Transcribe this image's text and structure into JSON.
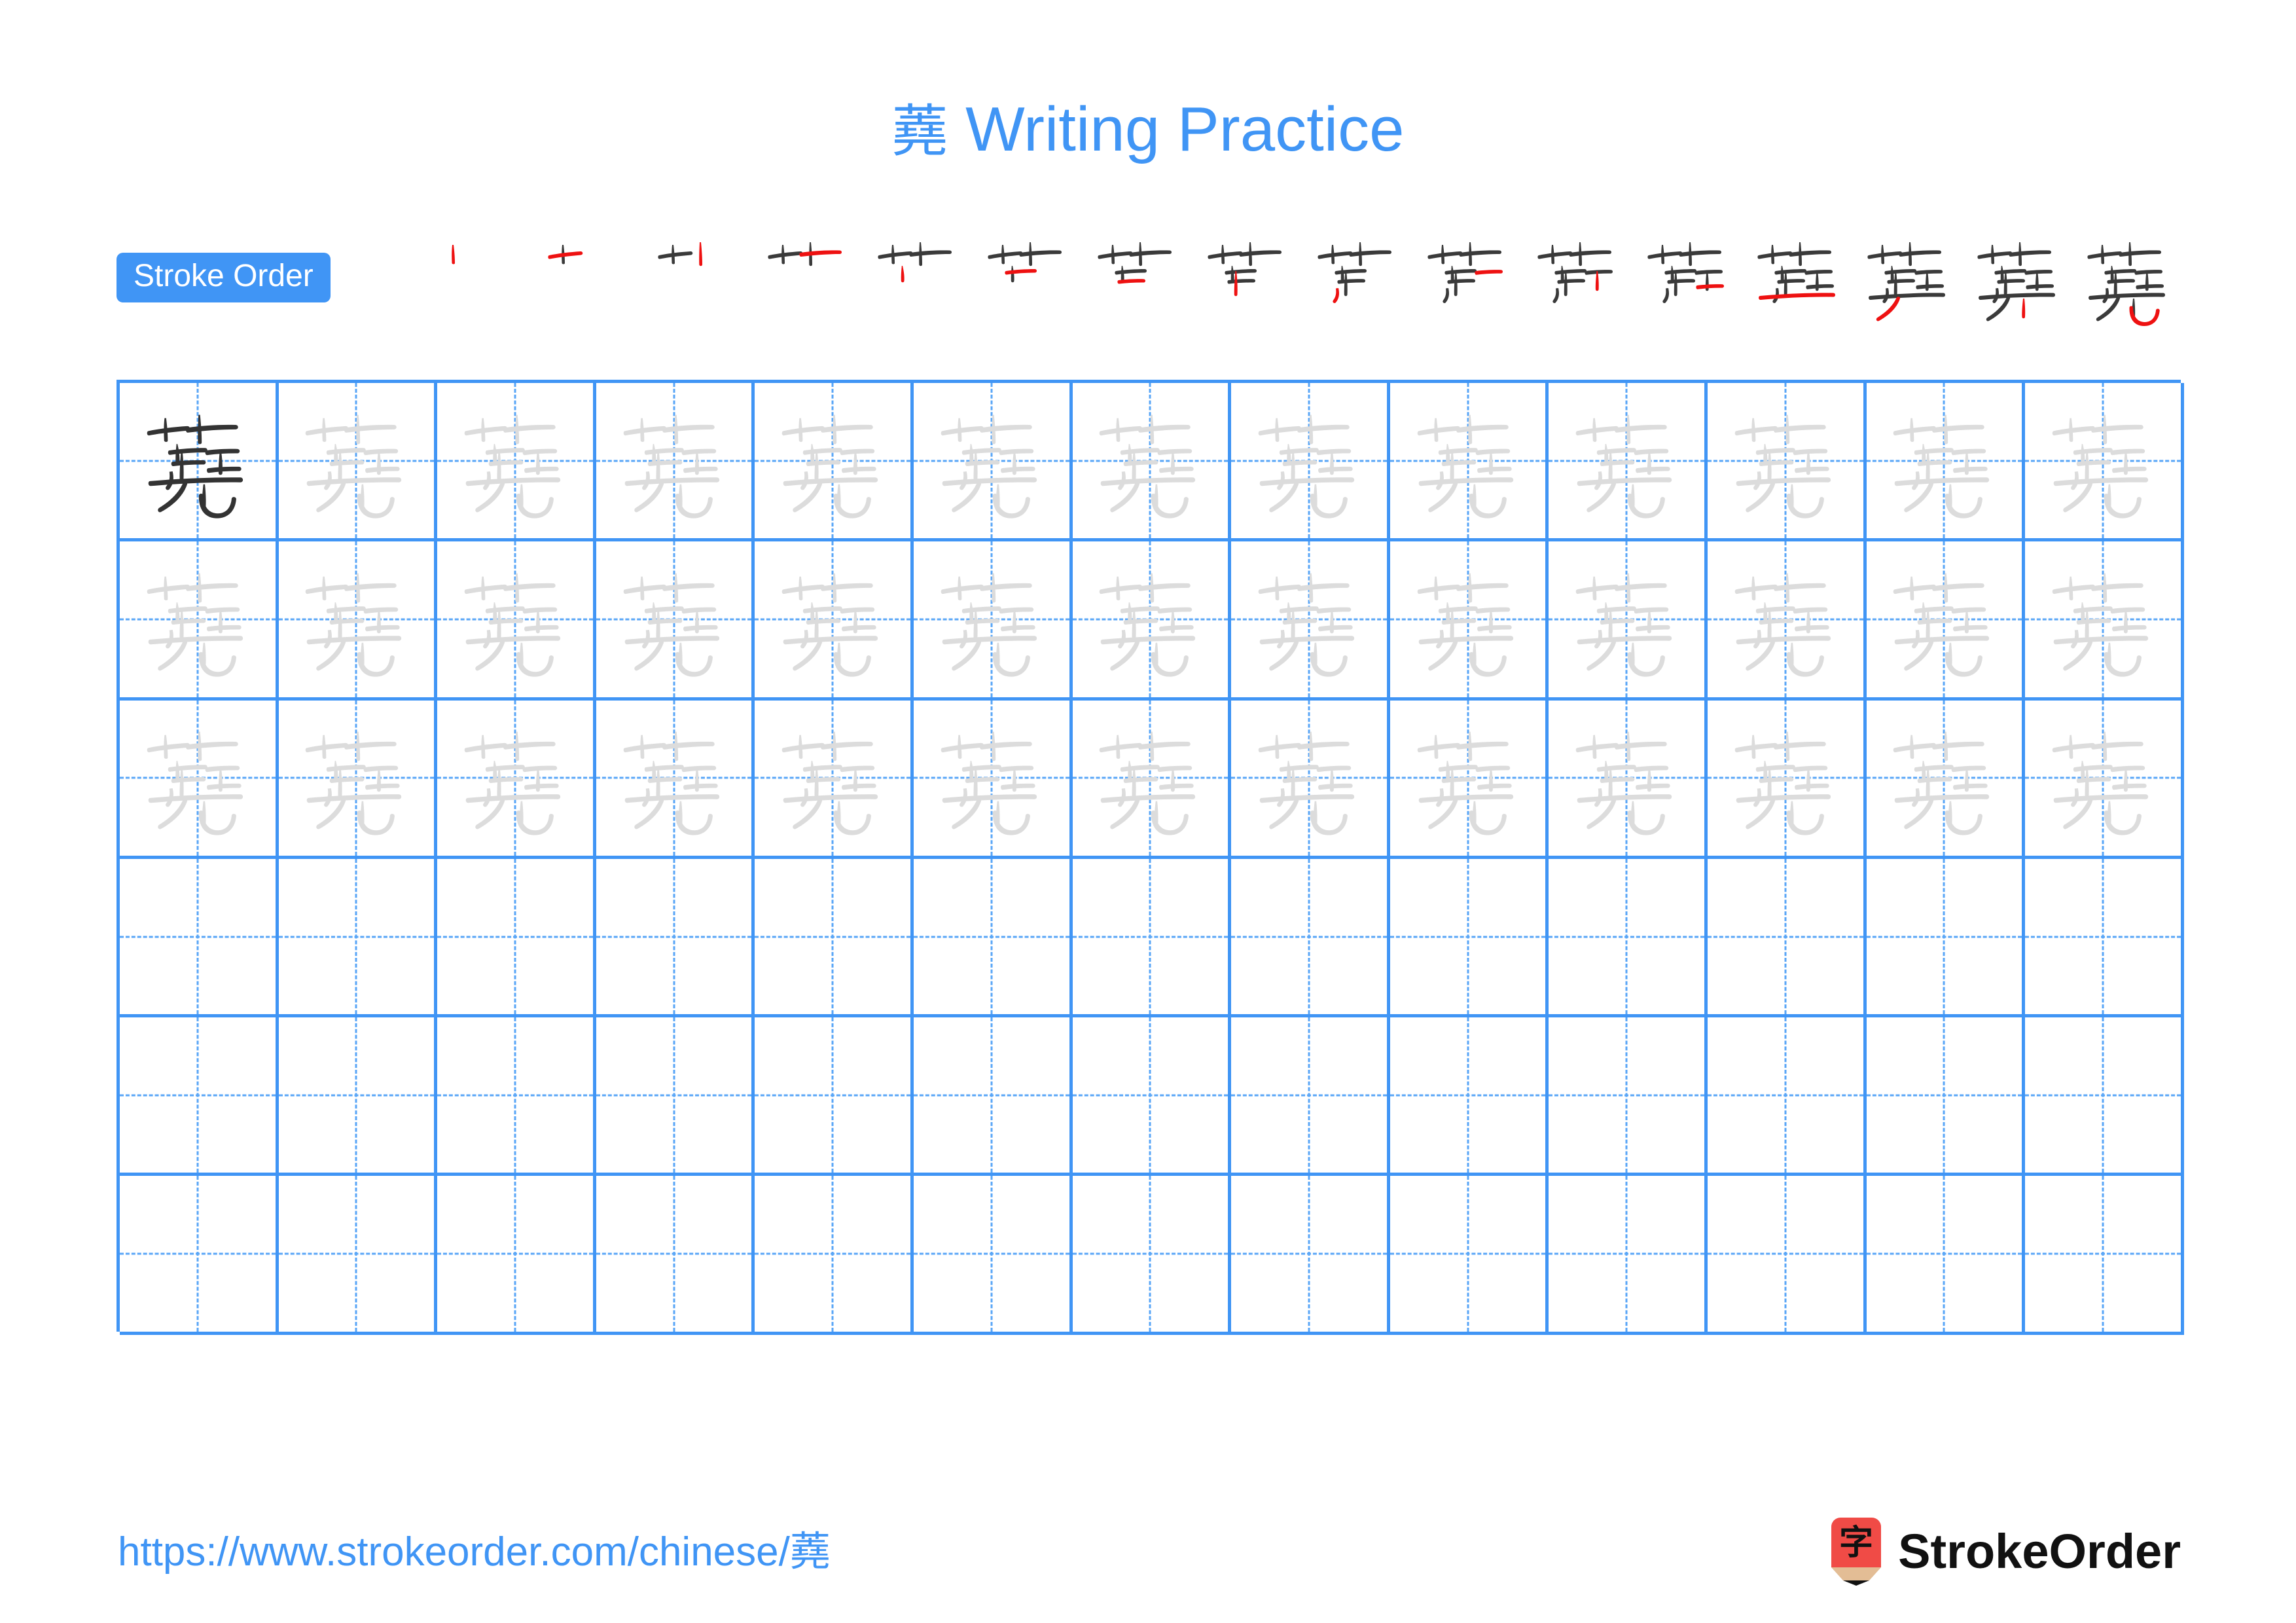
{
  "page": {
    "character": "蕘",
    "title_suffix": " Writing Practice",
    "accent_color": "#4095f5",
    "ghost_color": "#dcdcdc",
    "ink_color": "#333333",
    "new_stroke_color": "#ee1111",
    "background": "#ffffff"
  },
  "stroke_order": {
    "badge_label": "Stroke Order",
    "total_strokes": 16,
    "steps": [
      {
        "index": 1,
        "strokes_drawn": 1
      },
      {
        "index": 2,
        "strokes_drawn": 2
      },
      {
        "index": 3,
        "strokes_drawn": 3
      },
      {
        "index": 4,
        "strokes_drawn": 4
      },
      {
        "index": 5,
        "strokes_drawn": 5
      },
      {
        "index": 6,
        "strokes_drawn": 6
      },
      {
        "index": 7,
        "strokes_drawn": 7
      },
      {
        "index": 8,
        "strokes_drawn": 8
      },
      {
        "index": 9,
        "strokes_drawn": 9
      },
      {
        "index": 10,
        "strokes_drawn": 10
      },
      {
        "index": 11,
        "strokes_drawn": 11
      },
      {
        "index": 12,
        "strokes_drawn": 12
      },
      {
        "index": 13,
        "strokes_drawn": 13
      },
      {
        "index": 14,
        "strokes_drawn": 14
      },
      {
        "index": 15,
        "strokes_drawn": 15
      },
      {
        "index": 16,
        "strokes_drawn": 16
      }
    ]
  },
  "practice_grid": {
    "columns": 13,
    "rows": 6,
    "rows_data": [
      {
        "row": 1,
        "cells": [
          "dark",
          "ghost",
          "ghost",
          "ghost",
          "ghost",
          "ghost",
          "ghost",
          "ghost",
          "ghost",
          "ghost",
          "ghost",
          "ghost",
          "ghost"
        ]
      },
      {
        "row": 2,
        "cells": [
          "ghost",
          "ghost",
          "ghost",
          "ghost",
          "ghost",
          "ghost",
          "ghost",
          "ghost",
          "ghost",
          "ghost",
          "ghost",
          "ghost",
          "ghost"
        ]
      },
      {
        "row": 3,
        "cells": [
          "ghost",
          "ghost",
          "ghost",
          "ghost",
          "ghost",
          "ghost",
          "ghost",
          "ghost",
          "ghost",
          "ghost",
          "ghost",
          "ghost",
          "ghost"
        ]
      },
      {
        "row": 4,
        "cells": [
          "empty",
          "empty",
          "empty",
          "empty",
          "empty",
          "empty",
          "empty",
          "empty",
          "empty",
          "empty",
          "empty",
          "empty",
          "empty"
        ]
      },
      {
        "row": 5,
        "cells": [
          "empty",
          "empty",
          "empty",
          "empty",
          "empty",
          "empty",
          "empty",
          "empty",
          "empty",
          "empty",
          "empty",
          "empty",
          "empty"
        ]
      },
      {
        "row": 6,
        "cells": [
          "empty",
          "empty",
          "empty",
          "empty",
          "empty",
          "empty",
          "empty",
          "empty",
          "empty",
          "empty",
          "empty",
          "empty",
          "empty"
        ]
      }
    ]
  },
  "footer": {
    "url": "https://www.strokeorder.com/chinese/蕘",
    "brand_name": "StrokeOrder",
    "brand_logo_character": "字",
    "brand_logo_body_color": "#f04b46",
    "brand_logo_wood_color": "#e3bd95",
    "brand_logo_tip_color": "#111111"
  }
}
